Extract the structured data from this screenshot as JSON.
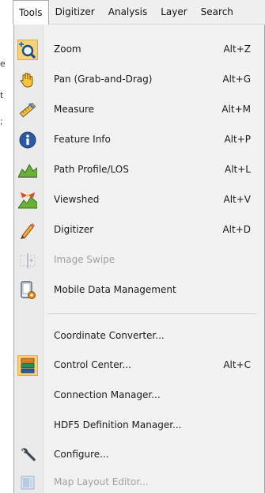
{
  "menubar": {
    "items": [
      {
        "label": "Tools",
        "active": true
      },
      {
        "label": "Digitizer",
        "active": false
      },
      {
        "label": "Analysis",
        "active": false
      },
      {
        "label": "Layer",
        "active": false
      },
      {
        "label": "Search",
        "active": false
      }
    ]
  },
  "menu": {
    "items": [
      {
        "label": "Zoom",
        "shortcut": "Alt+Z",
        "icon": "zoom-icon",
        "enabled": true,
        "selected": true
      },
      {
        "label": "Pan (Grab-and-Drag)",
        "shortcut": "Alt+G",
        "icon": "hand-pan-icon",
        "enabled": true
      },
      {
        "label": "Measure",
        "shortcut": "Alt+M",
        "icon": "ruler-icon",
        "enabled": true
      },
      {
        "label": "Feature Info",
        "shortcut": "Alt+P",
        "icon": "info-icon",
        "enabled": true
      },
      {
        "label": "Path Profile/LOS",
        "shortcut": "Alt+L",
        "icon": "path-profile-icon",
        "enabled": true
      },
      {
        "label": "Viewshed",
        "shortcut": "Alt+V",
        "icon": "viewshed-icon",
        "enabled": true
      },
      {
        "label": "Digitizer",
        "shortcut": "Alt+D",
        "icon": "pencil-icon",
        "enabled": true
      },
      {
        "label": "Image Swipe",
        "shortcut": "",
        "icon": "image-swipe-icon",
        "enabled": false
      },
      {
        "label": "Mobile Data Management",
        "shortcut": "",
        "icon": "mobile-data-icon",
        "enabled": true
      },
      {
        "label": "Coordinate Converter...",
        "shortcut": "",
        "icon": "",
        "enabled": true
      },
      {
        "label": "Control Center...",
        "shortcut": "Alt+C",
        "icon": "control-center-icon",
        "enabled": true,
        "selected": true
      },
      {
        "label": "Connection Manager...",
        "shortcut": "",
        "icon": "",
        "enabled": true
      },
      {
        "label": "HDF5 Definition Manager...",
        "shortcut": "",
        "icon": "",
        "enabled": true
      },
      {
        "label": "Configure...",
        "shortcut": "",
        "icon": "wrench-icon",
        "enabled": true
      },
      {
        "label": "Map Layout Editor...",
        "shortcut": "",
        "icon": "map-layout-icon",
        "enabled": false
      }
    ]
  },
  "colors": {
    "menubar_bg": "#f0f0f0",
    "menu_bg": "#f2f2f2",
    "selected_icon_bg": "#f6d27a",
    "disabled_text": "#a0a0a0"
  }
}
